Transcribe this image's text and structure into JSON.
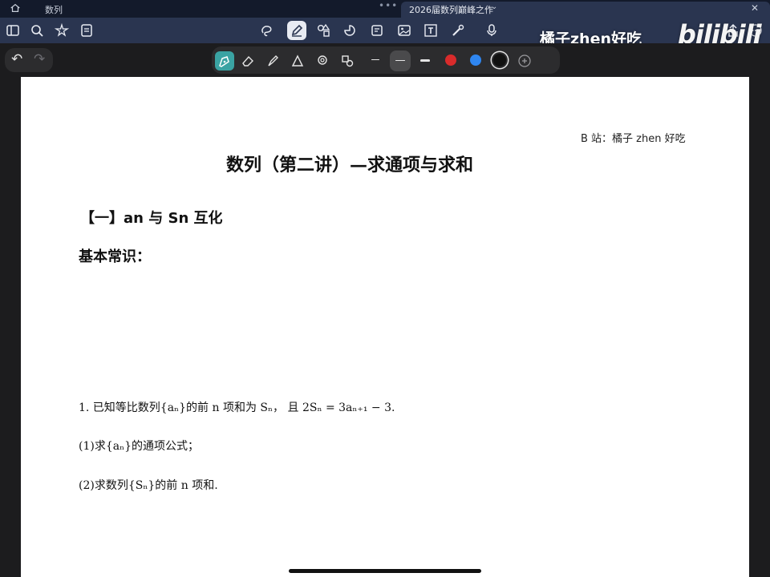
{
  "tabs": {
    "tab1_label": "数列",
    "tab2_label": "2026届数列巅峰之作",
    "dots": "•••"
  },
  "watermark": {
    "text": "橘子zhen好吃",
    "logo": "bilibili"
  },
  "pen_toolbar": {
    "colors": [
      "#d92b2b",
      "#2f86f0",
      "#111111"
    ]
  },
  "document": {
    "credit": "B 站：橘子 zhen 好吃",
    "title": "数列（第二讲）—求通项与求和",
    "section_heading": "【一】an 与 Sn 互化",
    "basics_heading": "基本常识：",
    "problem_line1": "1.  已知等比数列{aₙ}的前 n 项和为 Sₙ， 且 2Sₙ = 3aₙ₊₁ − 3.",
    "problem_line2": "(1)求{aₙ}的通项公式；",
    "problem_line3": "(2)求数列{Sₙ}的前 n 项和."
  },
  "icons": {
    "home": "home-icon",
    "sidebar": "sidebar-toggle-icon",
    "search": "search-icon",
    "bookmark": "bookmark-icon",
    "export": "export-icon",
    "lasso": "lasso-icon",
    "pen_mode": "pen-mode-icon",
    "shapes": "shapes-icon",
    "sticker": "sticker-icon",
    "note": "sticky-note-icon",
    "image": "image-icon",
    "text": "text-box-icon",
    "laser": "laser-pointer-icon",
    "mic": "microphone-icon",
    "share": "share-icon",
    "more": "more-icon"
  }
}
